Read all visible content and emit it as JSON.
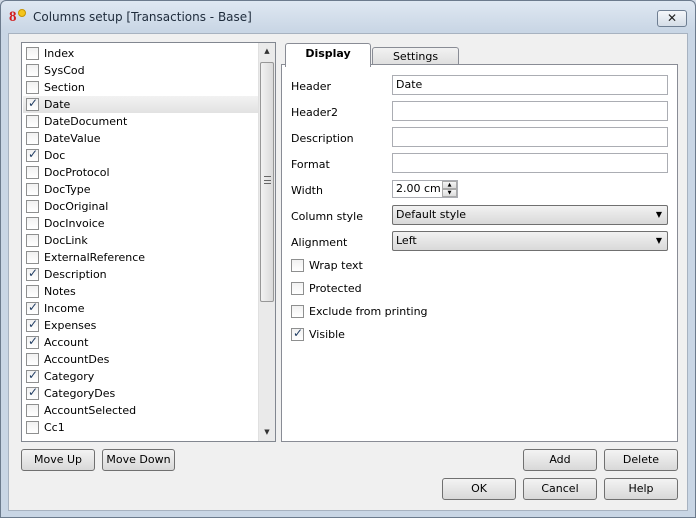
{
  "window": {
    "title": "Columns setup [Transactions - Base]",
    "close_glyph": "✕",
    "app_icon_glyph": "8"
  },
  "columns_list": {
    "items": [
      {
        "label": "Index",
        "checked": false
      },
      {
        "label": "SysCod",
        "checked": false
      },
      {
        "label": "Section",
        "checked": false
      },
      {
        "label": "Date",
        "checked": true,
        "selected": true
      },
      {
        "label": "DateDocument",
        "checked": false
      },
      {
        "label": "DateValue",
        "checked": false
      },
      {
        "label": "Doc",
        "checked": true
      },
      {
        "label": "DocProtocol",
        "checked": false
      },
      {
        "label": "DocType",
        "checked": false
      },
      {
        "label": "DocOriginal",
        "checked": false
      },
      {
        "label": "DocInvoice",
        "checked": false
      },
      {
        "label": "DocLink",
        "checked": false
      },
      {
        "label": "ExternalReference",
        "checked": false
      },
      {
        "label": "Description",
        "checked": true
      },
      {
        "label": "Notes",
        "checked": false
      },
      {
        "label": "Income",
        "checked": true
      },
      {
        "label": "Expenses",
        "checked": true
      },
      {
        "label": "Account",
        "checked": true
      },
      {
        "label": "AccountDes",
        "checked": false
      },
      {
        "label": "Category",
        "checked": true
      },
      {
        "label": "CategoryDes",
        "checked": true
      },
      {
        "label": "AccountSelected",
        "checked": false
      },
      {
        "label": "Cc1",
        "checked": false
      }
    ],
    "scroll_up_glyph": "▲",
    "scroll_down_glyph": "▼"
  },
  "tabs": [
    {
      "label": "Display",
      "active": true
    },
    {
      "label": "Settings",
      "active": false
    }
  ],
  "display_tab": {
    "header_label": "Header",
    "header_value": "Date",
    "header2_label": "Header2",
    "header2_value": "",
    "description_label": "Description",
    "description_value": "",
    "format_label": "Format",
    "format_value": "",
    "width_label": "Width",
    "width_value": "2.00 cm",
    "column_style_label": "Column style",
    "column_style_value": "Default style",
    "alignment_label": "Alignment",
    "alignment_value": "Left",
    "wrap_text_label": "Wrap text",
    "wrap_text_checked": false,
    "protected_label": "Protected",
    "protected_checked": false,
    "exclude_printing_label": "Exclude from printing",
    "exclude_printing_checked": false,
    "visible_label": "Visible",
    "visible_checked": true
  },
  "buttons": {
    "move_up": "Move Up",
    "move_down": "Move Down",
    "add": "Add",
    "delete": "Delete",
    "ok": "OK",
    "cancel": "Cancel",
    "help": "Help"
  }
}
